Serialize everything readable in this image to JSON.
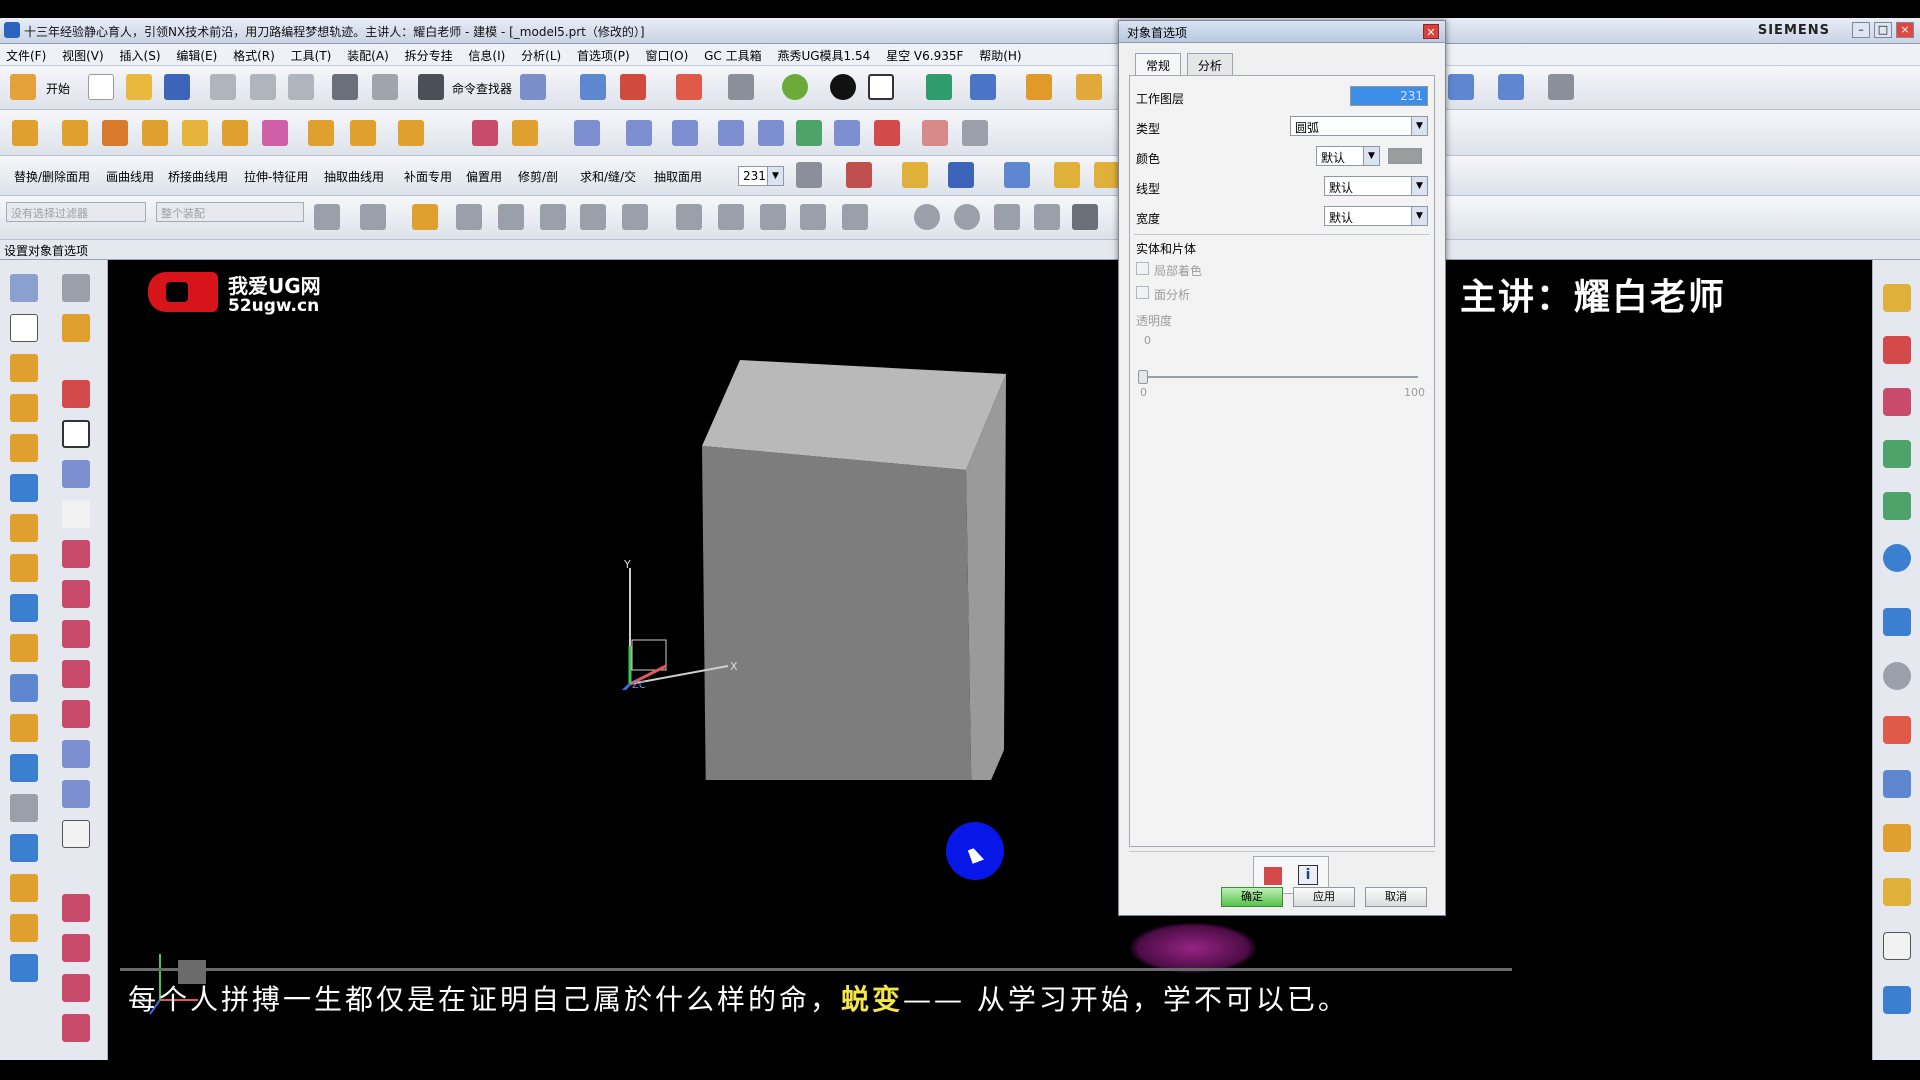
{
  "window": {
    "title": "十三年经验静心育人，引领NX技术前沿，用刀路编程梦想轨迹。主讲人：耀白老师 - 建模 - [_model5.prt（修改的）]",
    "brand": "SIEMENS"
  },
  "menu": [
    "文件(F)",
    "视图(V)",
    "插入(S)",
    "编辑(E)",
    "格式(R)",
    "工具(T)",
    "装配(A)",
    "拆分专挂",
    "信息(I)",
    "分析(L)",
    "首选项(P)",
    "窗口(O)",
    "GC 工具箱",
    "燕秀UG模具1.54",
    "星空 V6.935F",
    "帮助(H)"
  ],
  "toolbar1": {
    "start_label": "开始",
    "command_finder_label": "命令查找器"
  },
  "toolbar3": {
    "labels": [
      "替换/删除面用",
      "画曲线用",
      "桥接曲线用",
      "拉伸-特征用",
      "抽取曲线用",
      "补面专用",
      "偏置用",
      "修剪/剖",
      "求和/缝/交",
      "抽取面用"
    ],
    "layer_value": "231"
  },
  "toolbar4": {
    "filter_placeholder": "没有选择过滤器",
    "scope_placeholder": "整个装配"
  },
  "command_status": "设置对象首选项",
  "graphics": {
    "logo_line1": "我爱UG网",
    "logo_line2": "52ugw.cn",
    "teacher": "主讲：耀白老师",
    "subtitle_pre": "每个人拼搏一生都仅是在证明自己属於什么样的命，",
    "subtitle_hl": "蜕变",
    "subtitle_post": "—— 从学习开始，学不可以已。",
    "axis_x": "X",
    "axis_y": "Y",
    "axis_z": "ZC"
  },
  "dialog": {
    "title": "对象首选项",
    "tabs": [
      "常规",
      "分析"
    ],
    "work_layer_label": "工作图层",
    "work_layer_value": "231",
    "type_label": "类型",
    "type_value": "圆弧",
    "color_label": "颜色",
    "color_value": "默认",
    "linetype_label": "线型",
    "linetype_value": "默认",
    "width_label": "宽度",
    "width_value": "默认",
    "solid_section": "实体和片体",
    "partial_shading": "局部着色",
    "face_analysis": "面分析",
    "transparency_label": "透明度",
    "transparency_value": "0",
    "slider_min": "0",
    "slider_max": "100",
    "ok": "确定",
    "apply": "应用",
    "cancel": "取消"
  },
  "colors": {
    "accent": "#3c8ee8",
    "cursor_highlight": "#0717e8",
    "subtitle_highlight": "#f4e64a",
    "logo_red": "#d8141b"
  }
}
